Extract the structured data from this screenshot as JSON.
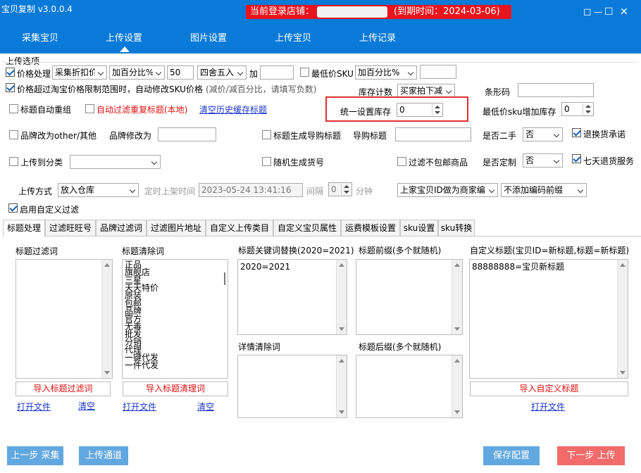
{
  "app": {
    "title": "宝贝复制 v3.0.0.4"
  },
  "banner": {
    "login_label": "当前登录店铺：",
    "expiry": "(到期时间：2024-03-06)"
  },
  "window_controls": {
    "restore": "◻",
    "minimize": "—",
    "maximize": "☐",
    "close": "✕"
  },
  "nav": {
    "tabs": [
      "采集宝贝",
      "上传设置",
      "图片设置",
      "上传宝贝",
      "上传记录"
    ],
    "active": "上传设置"
  },
  "upload_options": {
    "group_title": "上传选项",
    "price": {
      "label": "价格处理",
      "checked": true,
      "mode": "采集折扣价",
      "calc": "加百分比%",
      "value": "50",
      "rounding": "四舍五入",
      "add_label": "加",
      "add_value": ""
    },
    "min_sku": {
      "label": "最低价SKU",
      "checked": false,
      "calc": "加百分比%",
      "value": ""
    },
    "price_limit": {
      "label": "价格超过淘宝价格限制范围时，自动修改SKU价格",
      "note": "(减价/减百分比，请填写负数)",
      "checked": true
    },
    "stock_count": {
      "label": "库存计数",
      "value": "买家拍下减"
    },
    "barcode": {
      "label": "条形码",
      "value": ""
    },
    "title_regroup": {
      "label": "标题自动重组",
      "checked": false
    },
    "filter_dup": {
      "label": "自动过滤重复标题(本地)",
      "checked": false
    },
    "clear_history": "清空历史缓存标题",
    "unify_stock": {
      "label": "统一设置库存",
      "value": "0"
    },
    "min_sku_stock": {
      "label": "最低价sku增加库存",
      "value": "0"
    },
    "brand_other": {
      "label": "品牌改为other/其他",
      "checked": false
    },
    "brand_change": {
      "label": "品牌修改为",
      "value": ""
    },
    "gen_shopping_title": {
      "label": "标题生成导购标题",
      "checked": false
    },
    "shopping_title": {
      "label": "导购标题",
      "value": ""
    },
    "second_hand": {
      "label": "是否二手",
      "value": "否"
    },
    "return_promise": {
      "label": "退换货承诺",
      "checked": true
    },
    "upload_category": {
      "label": "上传到分类",
      "checked": false,
      "value": ""
    },
    "random_item_no": {
      "label": "随机生成货号",
      "checked": false
    },
    "filter_no_shipping": {
      "label": "过滤不包邮商品",
      "checked": false
    },
    "custom_made": {
      "label": "是否定制",
      "value": "否"
    },
    "seven_day": {
      "label": "七天退货服务",
      "checked": true
    },
    "upload_mode": {
      "label": "上传方式",
      "value": "放入仓库"
    },
    "scheduled": {
      "label": "定时上架时间",
      "value": "2023-05-24 13:41:16",
      "interval_label": "间隔",
      "interval": "0",
      "unit": "分钟"
    },
    "seller_id": {
      "value": "上家宝贝ID做为商家编"
    },
    "prefix_option": {
      "value": "不添加编码前缀"
    },
    "custom_filter": {
      "label": "启用自定义过滤",
      "checked": true
    }
  },
  "subtabs": {
    "items": [
      "标题处理",
      "过滤旺旺号",
      "品牌过滤词",
      "过滤图片地址",
      "自定义上传类目",
      "自定义宝贝属性",
      "运费模板设置",
      "sku设置",
      "sku转换"
    ],
    "active": "标题处理"
  },
  "title_panel": {
    "filter_words": {
      "label": "标题过滤词",
      "items": [],
      "import": "导入标题过滤词",
      "open": "打开文件",
      "clear": "清空"
    },
    "clean_words": {
      "label": "标题清除词",
      "items": [
        "正品",
        "旗舰店",
        "三星",
        "天天特价",
        "原装",
        "包邮",
        "品牌",
        "官方",
        "无毒",
        "批发",
        "分销",
        "代理",
        "一键代发",
        "一件代发"
      ],
      "import": "导入标题清理词",
      "open": "打开文件",
      "clear": "清空"
    },
    "replace": {
      "label": "标题关键词替换(2020=2021)",
      "items": [
        "2020=2021"
      ]
    },
    "detail_clean": {
      "label": "详情清除词",
      "items": []
    },
    "prefix": {
      "label": "标题前缀(多个就随机)",
      "items": []
    },
    "suffix": {
      "label": "标题后缀(多个就随机)",
      "items": []
    },
    "custom_title": {
      "label": "自定义标题(宝贝ID=新标题,标题=新标题)",
      "items": [
        "88888888=宝贝新标题"
      ],
      "import": "导入自定义标题",
      "open": "打开文件"
    }
  },
  "footer": {
    "prev": "上一步 采集",
    "channel": "上传通道",
    "save": "保存配置",
    "next": "下一步 上传"
  }
}
